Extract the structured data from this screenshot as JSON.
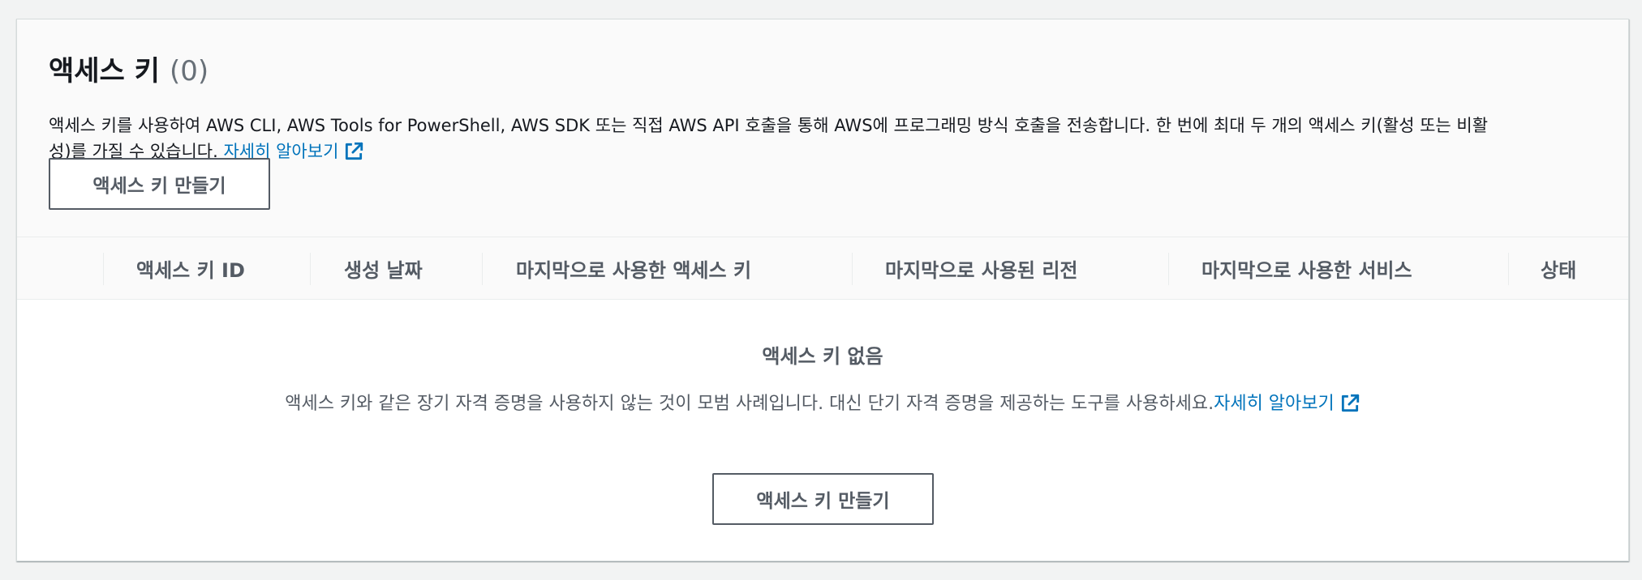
{
  "section": {
    "title": "액세스 키",
    "count": "(0)",
    "description_line1": "액세스 키를 사용하여 AWS CLI, AWS Tools for PowerShell, AWS SDK 또는 직접 AWS API 호출을 통해 AWS에 프로그래밍 방식 호출을 전송합니다. 한 번에 최대 두 개의 액세스 키(활성 또는 비활",
    "description_line2": "성)를 가질 수 있습니다.",
    "learn_more": "자세히 알아보기",
    "create_button": "액세스 키 만들기"
  },
  "table": {
    "columns": [
      "액세스 키 ID",
      "생성 날짜",
      "마지막으로 사용한 액세스 키",
      "마지막으로 사용된 리전",
      "마지막으로 사용한 서비스",
      "상태"
    ]
  },
  "empty_state": {
    "title": "액세스 키 없음",
    "description": "액세스 키와 같은 장기 자격 증명을 사용하지 않는 것이 모범 사례입니다. 대신 단기 자격 증명을 제공하는 도구를 사용하세요.",
    "learn_more": "자세히 알아보기",
    "create_button": "액세스 키 만들기"
  },
  "icons": {
    "external_link": "external-link-icon"
  },
  "colors": {
    "link": "#0073bb",
    "background": "#f2f3f3",
    "header_background": "#fafafa",
    "button_border": "#545b64",
    "muted_text": "#545b64",
    "count_text": "#687078"
  }
}
